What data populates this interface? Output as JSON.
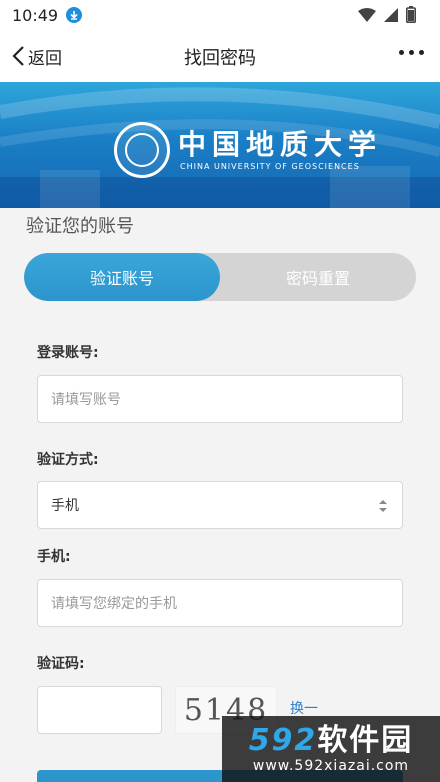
{
  "status_bar": {
    "time": "10:49",
    "download_icon": "download-icon",
    "wifi_icon": "wifi-icon",
    "signal_icon": "signal-icon",
    "battery_icon": "battery-icon"
  },
  "header": {
    "back_label": "返回",
    "title": "找回密码",
    "more_icon": "more-dots-icon"
  },
  "banner": {
    "logo_cn": "中国地质大学",
    "logo_en": "CHINA UNIVERSITY OF GEOSCIENCES"
  },
  "form": {
    "section_title": "验证您的账号",
    "tabs": [
      {
        "label": "验证账号",
        "active": true
      },
      {
        "label": "密码重置",
        "active": false
      }
    ],
    "account_label": "登录账号:",
    "account_placeholder": "请填写账号",
    "method_label": "验证方式:",
    "method_value": "手机",
    "phone_label": "手机:",
    "phone_placeholder": "请填写您绑定的手机",
    "captcha_label": "验证码:",
    "captcha_text": "5148",
    "refresh_label": "换一"
  },
  "watermark": {
    "number": "592",
    "text": "软件园",
    "url": "www.592xiazai.com"
  },
  "colors": {
    "accent": "#2b95cc",
    "banner": "#1a7fc6",
    "inactive_tab": "#d4d4d4"
  }
}
